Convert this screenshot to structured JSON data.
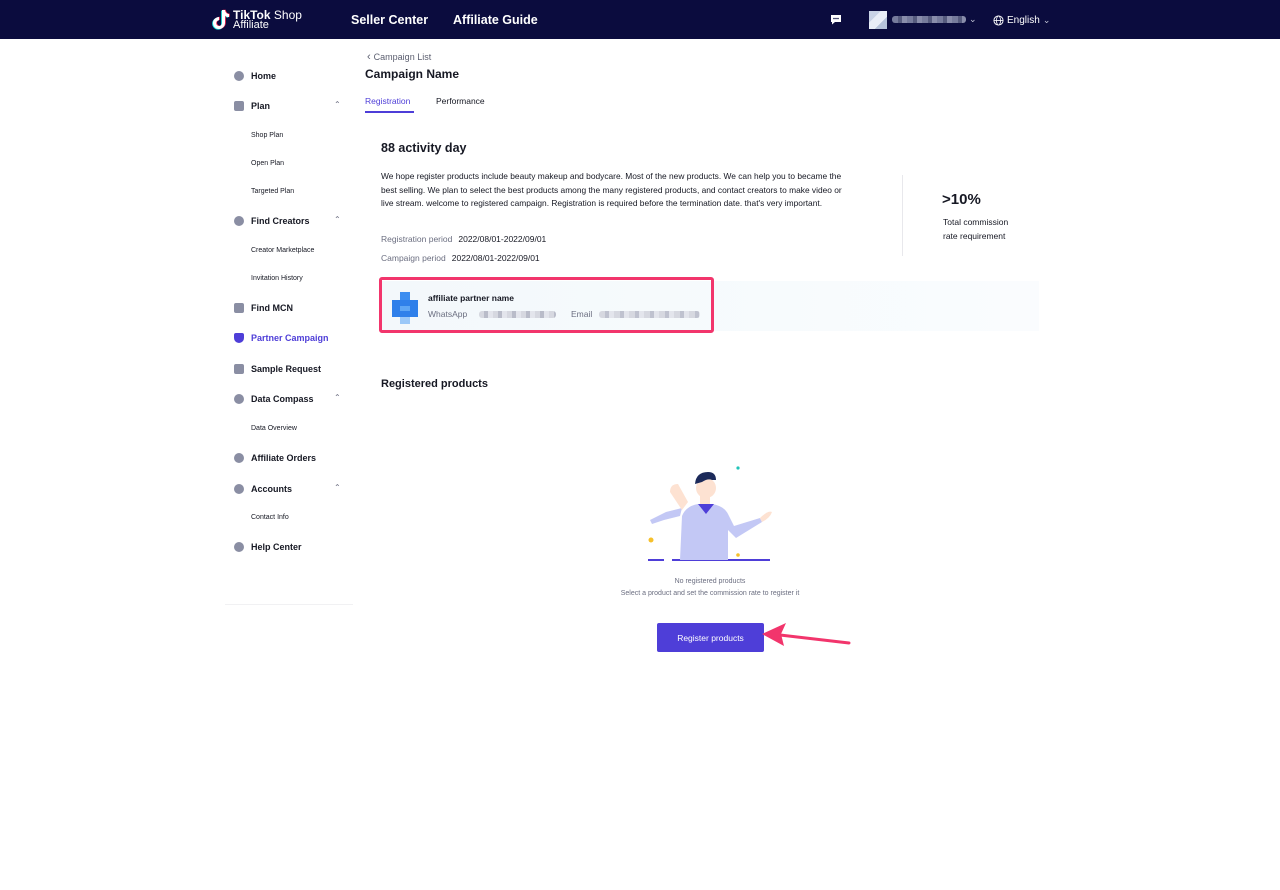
{
  "topbar": {
    "brand_line1": "TikTok",
    "brand_line1b": "Shop",
    "brand_line2": "Affiliate",
    "nav": [
      "Seller Center",
      "Affiliate Guide"
    ],
    "language": "English"
  },
  "sidebar": {
    "items": [
      {
        "label": "Home",
        "icon": "home-icon"
      },
      {
        "label": "Plan",
        "icon": "plan-icon",
        "expanded": true,
        "children": [
          "Shop Plan",
          "Open Plan",
          "Targeted Plan"
        ]
      },
      {
        "label": "Find Creators",
        "icon": "search-icon",
        "expanded": true,
        "children": [
          "Creator Marketplace",
          "Invitation History"
        ]
      },
      {
        "label": "Find MCN",
        "icon": "building-icon"
      },
      {
        "label": "Partner Campaign",
        "icon": "shield-icon",
        "active": true
      },
      {
        "label": "Sample Request",
        "icon": "box-icon"
      },
      {
        "label": "Data Compass",
        "icon": "compass-icon",
        "expanded": true,
        "children": [
          "Data Overview"
        ]
      },
      {
        "label": "Affiliate Orders",
        "icon": "orders-icon"
      },
      {
        "label": "Accounts",
        "icon": "user-icon",
        "expanded": true,
        "children": [
          "Contact Info"
        ]
      },
      {
        "label": "Help Center",
        "icon": "help-icon"
      }
    ]
  },
  "main": {
    "breadcrumb": "Campaign List",
    "title": "Campaign Name",
    "tabs": [
      "Registration",
      "Performance"
    ],
    "active_tab": "Registration",
    "campaign": {
      "name": "88 activity day",
      "description": "We hope register products include beauty makeup and bodycare. Most of the new products. We can help you to became the best selling. We plan to select the best products among the many registered products, and contact creators to make video or live stream. welcome to registered campaign.  Registration is required before the termination date. that's very important.",
      "registration_period_label": "Registration period",
      "registration_period": "2022/08/01-2022/09/01",
      "campaign_period_label": "Campaign period",
      "campaign_period": "2022/08/01-2022/09/01",
      "commission_value": ">10%",
      "commission_label": "Total commission rate requirement"
    },
    "partner": {
      "name": "affiliate partner name",
      "whatsapp_label": "WhatsApp",
      "email_label": "Email"
    },
    "registered_products": {
      "title": "Registered products",
      "empty_title": "No registered products",
      "empty_hint": "Select a product and set the commission rate to register it",
      "button": "Register products"
    }
  },
  "colors": {
    "topbar": "#0b0c3e",
    "accent": "#4e3ed8",
    "highlight": "#f2356c"
  }
}
